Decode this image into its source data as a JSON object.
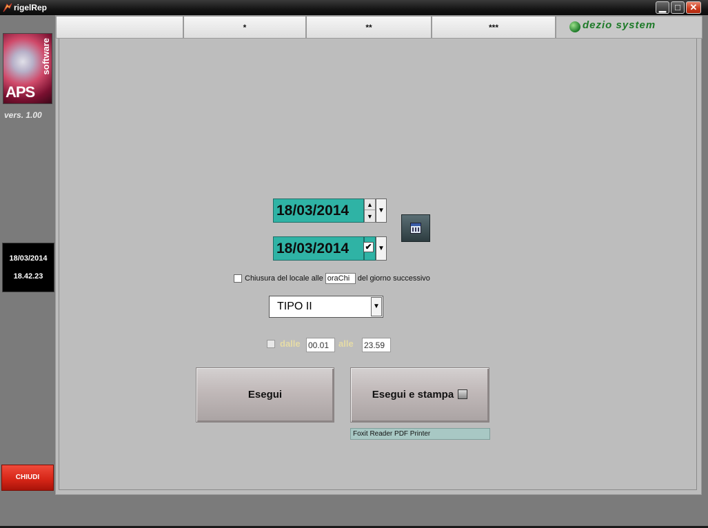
{
  "window": {
    "title": "rigelRep"
  },
  "sidebar": {
    "logo_text": "APS",
    "logo_sub": "software",
    "version": "vers. 1.00",
    "clock_date": "18/03/2014",
    "clock_time": "18.42.23",
    "close_label": "CHIUDI"
  },
  "tabs": [
    {
      "label": ""
    },
    {
      "label": "*"
    },
    {
      "label": "**"
    },
    {
      "label": "***"
    }
  ],
  "brand": "dezio system",
  "form": {
    "date_from": "18/03/2014",
    "date_to": "18/03/2014",
    "closing_prefix": "Chiusura del locale alle",
    "closing_time": "oraChi",
    "closing_suffix": "del giorno successivo",
    "type_value": "TIPO II",
    "time_from_label": "dalle",
    "time_from": "00.01",
    "time_to_label": "alle",
    "time_to": "23.59",
    "run_label": "Esegui",
    "run_print_label": "Esegui e stampa",
    "printer": "Foxit Reader PDF Printer"
  },
  "colors": {
    "date_field_bg": "#2fb3a5",
    "close_button": "#d42416",
    "brand_green": "#1d7a28"
  }
}
